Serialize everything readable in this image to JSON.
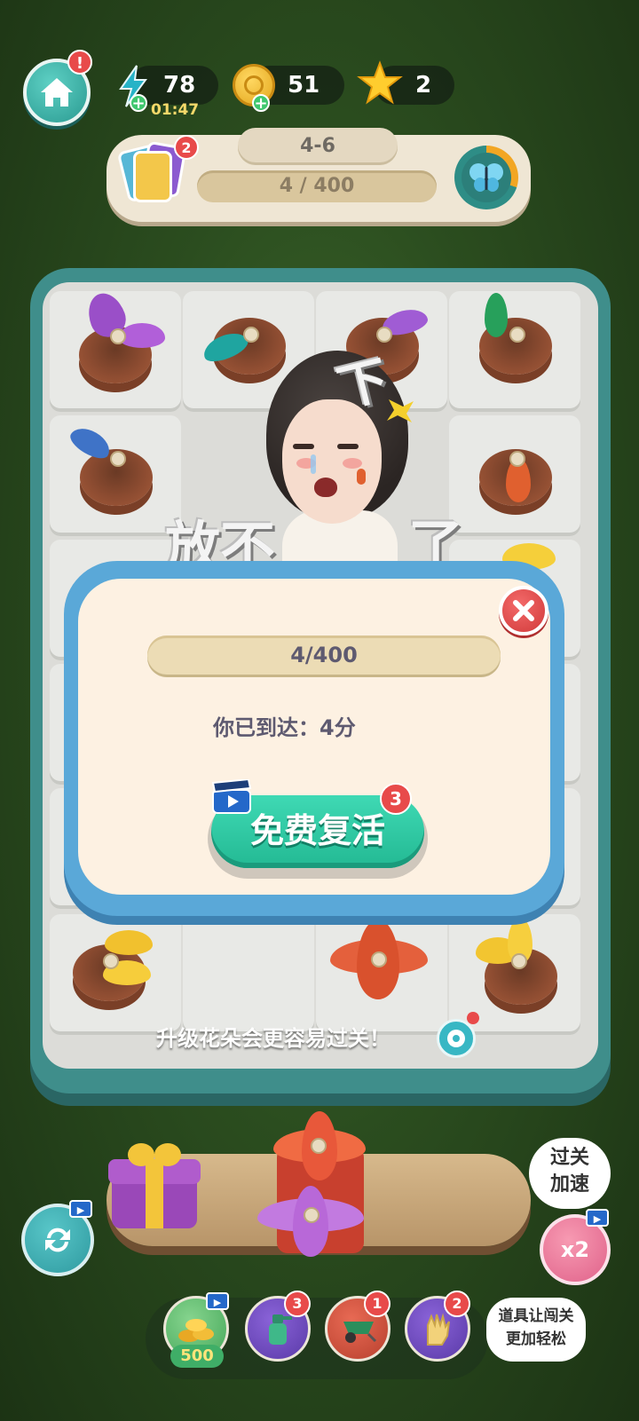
{
  "hud": {
    "energy": "78",
    "energy_timer": "01:47",
    "coins": "51",
    "stars": "2",
    "home_alert": "!"
  },
  "level": {
    "name": "4-6",
    "progress": "4 / 400",
    "card_count": "2"
  },
  "meme": {
    "word_1": "放不",
    "word_2": "下",
    "word_3": "了"
  },
  "popup": {
    "progress": "4/400",
    "reached_text": "你已到达：4分",
    "revive_label": "免费复活",
    "revive_count": "3"
  },
  "tip": {
    "text": "升级花朵会更容易过关！"
  },
  "bottom": {
    "speed_label_line1": "过关",
    "speed_label_line2": "加速",
    "speed_multiplier": "x2",
    "tools_hint_line1": "道具让闯关",
    "tools_hint_line2": "更加轻松",
    "tools": [
      {
        "name": "coin-pile",
        "cost": "500"
      },
      {
        "name": "spray-bottle",
        "badge": "3"
      },
      {
        "name": "wheelbarrow",
        "badge": "1"
      },
      {
        "name": "glove",
        "badge": "2"
      }
    ]
  },
  "colors": {
    "board": "#3f8e8b",
    "popup_border": "#5aa8d8",
    "revive_green": "#23b993",
    "badge_red": "#e84a4a"
  }
}
